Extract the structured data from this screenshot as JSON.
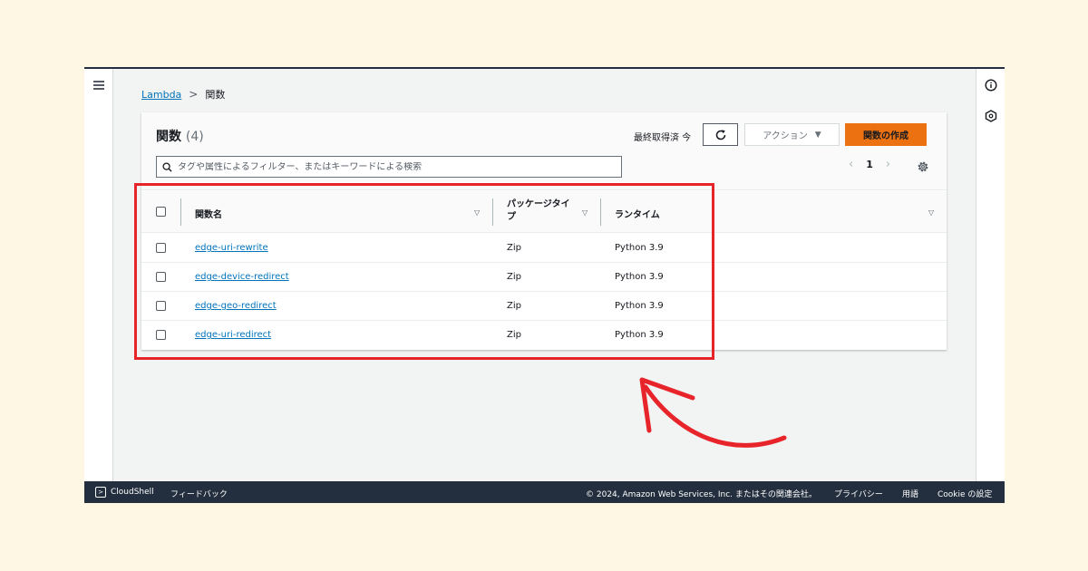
{
  "breadcrumb": {
    "root": "Lambda",
    "separator": ">",
    "current": "関数"
  },
  "panel": {
    "title": "関数",
    "count": "(4)",
    "last_fetched": "最終取得済 今",
    "action_label": "アクション",
    "create_label": "関数の作成",
    "search_placeholder": "タグや属性によるフィルター、またはキーワードによる検索",
    "page": "1",
    "prev": "‹",
    "next": "›"
  },
  "table": {
    "headers": {
      "name": "関数名",
      "package_type": "パッケージタイプ",
      "runtime": "ランタイム"
    },
    "rows": [
      {
        "name": "edge-uri-rewrite",
        "package_type": "Zip",
        "runtime": "Python 3.9"
      },
      {
        "name": "edge-device-redirect",
        "package_type": "Zip",
        "runtime": "Python 3.9"
      },
      {
        "name": "edge-geo-redirect",
        "package_type": "Zip",
        "runtime": "Python 3.9"
      },
      {
        "name": "edge-uri-redirect",
        "package_type": "Zip",
        "runtime": "Python 3.9"
      }
    ]
  },
  "footer": {
    "cloudshell": "CloudShell",
    "feedback": "フィードバック",
    "copyright": "© 2024, Amazon Web Services, Inc. またはその関連会社。",
    "privacy": "プライバシー",
    "terms": "用語",
    "cookie": "Cookie の設定"
  },
  "colors": {
    "accent": "#ec7211",
    "link": "#0073bb",
    "annotation": "#e8242b",
    "footer_bg": "#232f3e",
    "page_bg": "#fdf7e4"
  }
}
